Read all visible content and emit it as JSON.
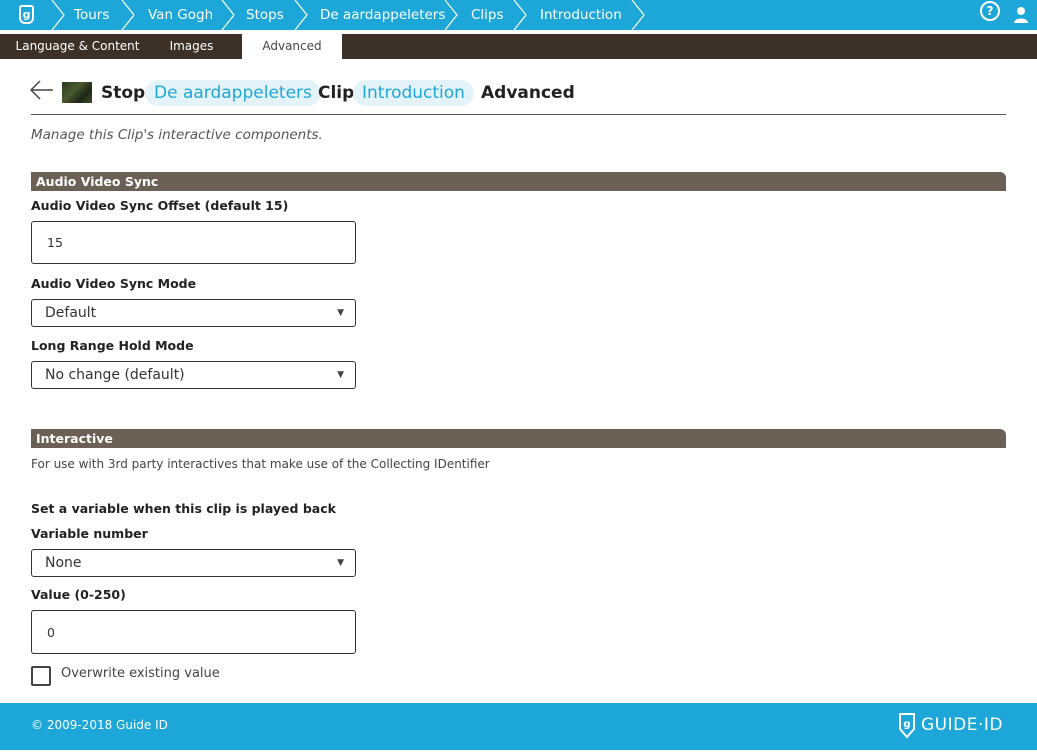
{
  "breadcrumbs": [
    "Tours",
    "Van Gogh",
    "Stops",
    "De aardappeleters",
    "Clips",
    "Introduction"
  ],
  "logo_glyph": "g",
  "help_glyph": "?",
  "tabs": [
    "Language & Content",
    "Images",
    "Advanced"
  ],
  "active_tab": "Advanced",
  "header": {
    "stop_label": "Stop",
    "stop_name": "De aardappeleters",
    "clip_label": "Clip",
    "clip_name": "Introduction",
    "section": "Advanced"
  },
  "intro_text": "Manage this Clip's interactive components.",
  "audio_video_sync": {
    "title": "Audio Video Sync",
    "offset_label": "Audio Video Sync Offset (default 15)",
    "offset_value": "15",
    "mode_label": "Audio Video Sync Mode",
    "mode_value": "Default",
    "hold_label": "Long Range Hold Mode",
    "hold_value": "No change (default)"
  },
  "interactive": {
    "title": "Interactive",
    "note": "For use with 3rd party interactives that make use of the Collecting IDentifier",
    "set_variable_label": "Set a variable when this clip is played back",
    "variable_label": "Variable number",
    "variable_value": "None",
    "value_label": "Value (0-250)",
    "value_value": "0",
    "overwrite_label": "Overwrite existing value",
    "overwrite_checked": false
  },
  "footer": {
    "copyright": "© 2009-2018 Guide ID",
    "brand": "GUIDE·ID"
  },
  "colors": {
    "brand_blue": "#1da7d8",
    "tab_bar": "#3c3128",
    "section_bar": "#6b6055"
  },
  "icons": [
    "guide-id-logo-icon",
    "help-icon",
    "user-icon",
    "back-arrow-icon",
    "chevron-down-icon",
    "chevron-separator-icon"
  ]
}
